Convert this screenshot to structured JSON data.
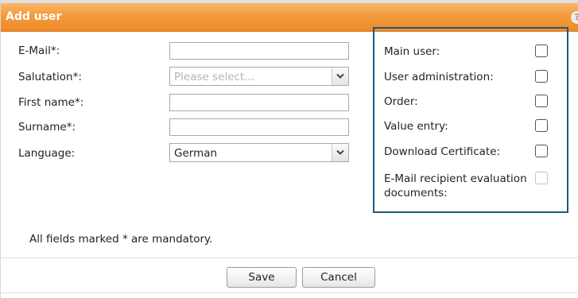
{
  "dialog": {
    "title": "Add user",
    "help_glyph": "?"
  },
  "form": {
    "email": {
      "label": "E-Mail*:",
      "value": ""
    },
    "salutation": {
      "label": "Salutation*:",
      "placeholder": "Please select..."
    },
    "first_name": {
      "label": "First name*:",
      "value": ""
    },
    "surname": {
      "label": "Surname*:",
      "value": ""
    },
    "language": {
      "label": "Language:",
      "value": "German"
    }
  },
  "permissions": [
    {
      "label": "Main user:",
      "checked": false,
      "enabled": true
    },
    {
      "label": "User administration:",
      "checked": false,
      "enabled": true
    },
    {
      "label": "Order:",
      "checked": false,
      "enabled": true
    },
    {
      "label": "Value entry:",
      "checked": false,
      "enabled": true
    },
    {
      "label": "Download Certificate:",
      "checked": false,
      "enabled": true
    },
    {
      "label": "E-Mail recipient evaluation documents:",
      "checked": false,
      "enabled": false
    }
  ],
  "note": "All fields marked * are mandatory.",
  "buttons": {
    "save": "Save",
    "cancel": "Cancel"
  },
  "colors": {
    "titlebar": "#f39b3c",
    "accent_border": "#1d5a80"
  },
  "icons": {
    "help": "help-icon",
    "dropdown": "chevron-down-icon"
  }
}
